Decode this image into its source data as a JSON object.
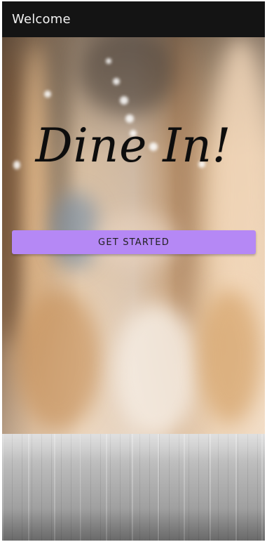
{
  "app_bar": {
    "title": "Welcome"
  },
  "hero": {
    "title": "Dine In!"
  },
  "actions": {
    "get_started_label": "GET STARTED"
  },
  "colors": {
    "app_bar_bg": "#141414",
    "accent": "#b588f5",
    "title_text": "#0d0d0d"
  }
}
